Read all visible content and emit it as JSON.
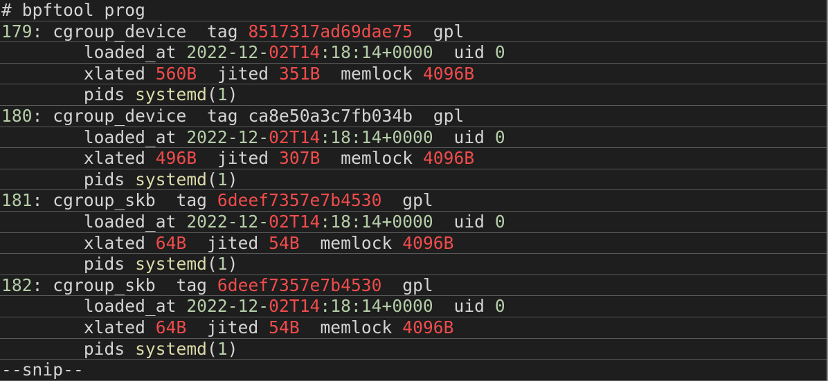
{
  "command": {
    "prompt": "#",
    "text": "bpftool prog"
  },
  "programs": [
    {
      "id": "179",
      "type": "cgroup_device",
      "tag": "8517317ad69dae75",
      "tag_highlight": true,
      "license": "gpl",
      "loaded_at_date": "2022-12-",
      "loaded_at_day_hour": "02T14",
      "loaded_at_rest": ":18:14+0000",
      "uid": "0",
      "xlated": "560B",
      "jited": "351B",
      "memlock": "4096B",
      "pid_name": "systemd",
      "pid": "1"
    },
    {
      "id": "180",
      "type": "cgroup_device",
      "tag": "ca8e50a3c7fb034b",
      "tag_highlight": false,
      "license": "gpl",
      "loaded_at_date": "2022-12-",
      "loaded_at_day_hour": "02T14",
      "loaded_at_rest": ":18:14+0000",
      "uid": "0",
      "xlated": "496B",
      "jited": "307B",
      "memlock": "4096B",
      "pid_name": "systemd",
      "pid": "1"
    },
    {
      "id": "181",
      "type": "cgroup_skb",
      "tag": "6deef7357e7b4530",
      "tag_highlight": true,
      "license": "gpl",
      "loaded_at_date": "2022-12-",
      "loaded_at_day_hour": "02T14",
      "loaded_at_rest": ":18:14+0000",
      "uid": "0",
      "xlated": "64B",
      "jited": "54B",
      "memlock": "4096B",
      "pid_name": "systemd",
      "pid": "1"
    },
    {
      "id": "182",
      "type": "cgroup_skb",
      "tag": "6deef7357e7b4530",
      "tag_highlight": true,
      "license": "gpl",
      "loaded_at_date": "2022-12-",
      "loaded_at_day_hour": "02T14",
      "loaded_at_rest": ":18:14+0000",
      "uid": "0",
      "xlated": "64B",
      "jited": "54B",
      "memlock": "4096B",
      "pid_name": "systemd",
      "pid": "1"
    }
  ],
  "labels": {
    "tag": "tag",
    "loaded_at": "loaded_at",
    "uid": "uid",
    "xlated": "xlated",
    "jited": "jited",
    "memlock": "memlock",
    "pids": "pids"
  },
  "footer": "--snip--",
  "colors": {
    "background": "#1e1e1e",
    "text": "#d4d4d4",
    "number": "#b5cea8",
    "highlight": "#f14c4c",
    "function": "#dcdcaa",
    "separator": "#5a5a5a"
  }
}
